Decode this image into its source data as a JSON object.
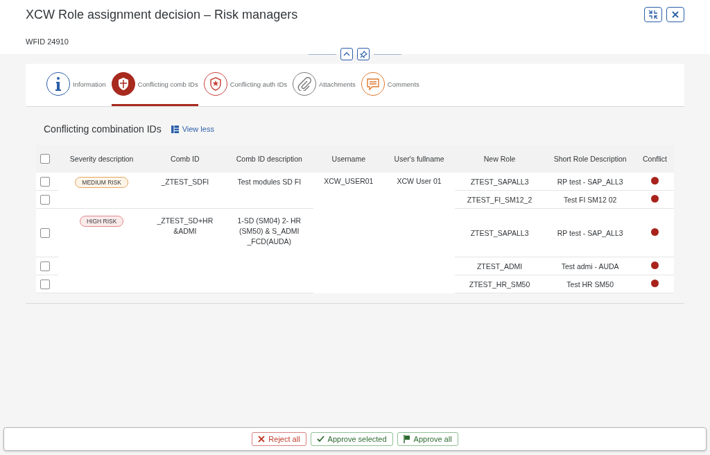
{
  "header": {
    "title": "XCW Role assignment decision – Risk managers",
    "subtitle": "WFID 24910"
  },
  "tabs": [
    {
      "kind": "info",
      "label": "Information",
      "color": "#2b5fa8",
      "selected": false
    },
    {
      "kind": "shield",
      "label": "Conflicting comb IDs",
      "color": "#a82a1f",
      "selected": true
    },
    {
      "kind": "badge",
      "label": "Conflicting auth IDs",
      "color": "#c8413a",
      "selected": false
    },
    {
      "kind": "clip",
      "label": "Attachments",
      "color": "#7a7a7a",
      "selected": false
    },
    {
      "kind": "comment",
      "label": "Comments",
      "color": "#e07a2f",
      "selected": false
    }
  ],
  "section": {
    "title": "Conflicting combination IDs",
    "link": "View less"
  },
  "table": {
    "columns": [
      "Severity description",
      "Comb ID",
      "Comb ID description",
      "Username",
      "User's fullname",
      "New Role",
      "Short Role Description",
      "Conflict"
    ],
    "select_all_checked": false,
    "user": {
      "username": "XCW_USER01",
      "fullname": "XCW User 01"
    },
    "groups": [
      {
        "severity": "MEDIUM RISK",
        "kind": "medium",
        "comb_id": "_ZTEST_SDFI",
        "comb_description": "Test modules SD FI",
        "rows": [
          {
            "checked": false,
            "new_role": "ZTEST_SAPALL3",
            "short_role_description": "RP test - SAP_ALL3",
            "conflict": true
          },
          {
            "checked": false,
            "new_role": "ZTEST_FI_SM12_2",
            "short_role_description": "Test FI SM12 02",
            "conflict": true
          }
        ]
      },
      {
        "severity": "HIGH RISK",
        "kind": "high",
        "comb_id": "_ZTEST_SD+HR&ADMI",
        "comb_description": "1-SD (SM04) 2- HR (SM50) & S_ADMI_FCD(AUDA)",
        "rows": [
          {
            "checked": false,
            "new_role": "ZTEST_SAPALL3",
            "short_role_description": "RP test - SAP_ALL3",
            "conflict": true
          },
          {
            "checked": false,
            "new_role": "ZTEST_ADMI",
            "short_role_description": "Test admi - AUDA",
            "conflict": true
          },
          {
            "checked": false,
            "new_role": "ZTEST_HR_SM50",
            "short_role_description": "Test HR SM50",
            "conflict": true
          }
        ]
      }
    ]
  },
  "footer": {
    "buttons": [
      {
        "kind": "reject",
        "label": "Reject all"
      },
      {
        "kind": "approve",
        "label": "Approve selected"
      },
      {
        "kind": "approve_all",
        "label": "Approve all"
      }
    ]
  }
}
